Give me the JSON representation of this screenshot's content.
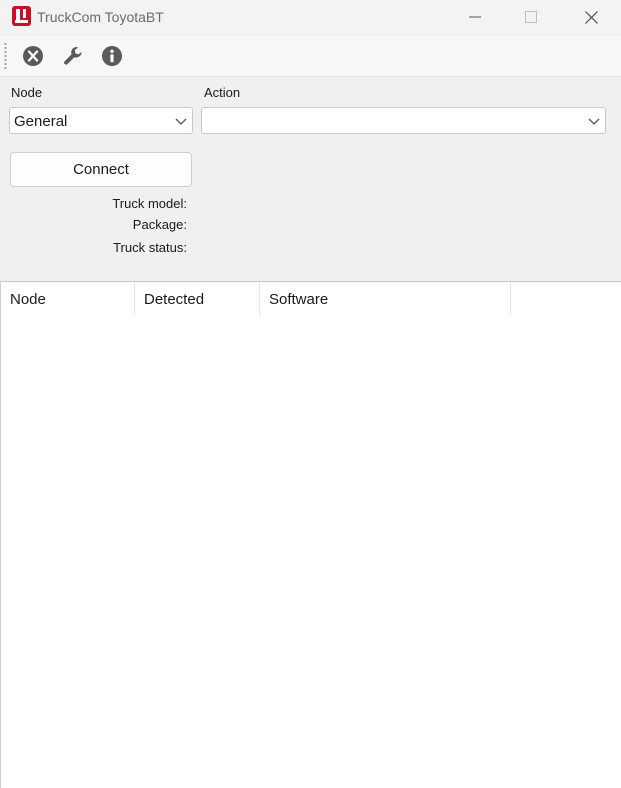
{
  "window": {
    "title": "TruckCom ToyotaBT",
    "controls": [
      "minimize",
      "maximize",
      "close"
    ],
    "accent_color": "#c8102e"
  },
  "toolbar": {
    "buttons": [
      {
        "icon": "close-circle-icon"
      },
      {
        "icon": "wrench-icon"
      },
      {
        "icon": "info-icon"
      }
    ]
  },
  "form": {
    "node_label": "Node",
    "node_value": "General",
    "action_label": "Action",
    "action_value": "",
    "connect_label": "Connect",
    "truck_model_label": "Truck model:",
    "package_label": "Package:",
    "truck_status_label": "Truck status:"
  },
  "table": {
    "columns": [
      "Node",
      "Detected",
      "Software"
    ],
    "rows": []
  }
}
